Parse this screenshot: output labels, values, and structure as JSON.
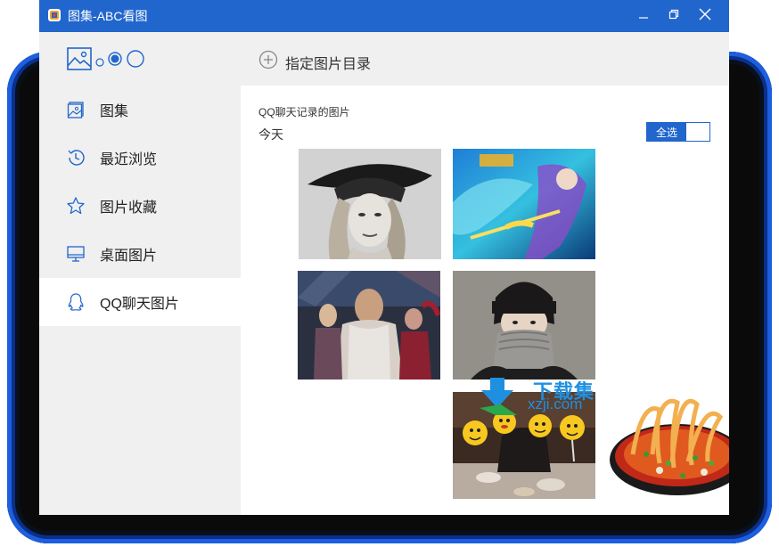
{
  "window": {
    "title": "图集-ABC看图",
    "controls": [
      "minimize-icon",
      "restore-icon",
      "close-icon"
    ],
    "accent": "#2166cc"
  },
  "sidebar": {
    "view_toggle": [
      "image-view-icon",
      "small-dot",
      "medium-dot-selected",
      "large-circle"
    ],
    "items": [
      {
        "label": "图集",
        "icon": "gallery-icon",
        "active": false
      },
      {
        "label": "最近浏览",
        "icon": "history-icon",
        "active": false
      },
      {
        "label": "图片收藏",
        "icon": "star-icon",
        "active": false
      },
      {
        "label": "桌面图片",
        "icon": "monitor-icon",
        "active": false
      },
      {
        "label": "QQ聊天图片",
        "icon": "qq-penguin-icon",
        "active": true
      }
    ]
  },
  "main": {
    "add_directory_label": "指定图片目录",
    "section_title": "QQ聊天记录的图片",
    "day_label": "今天",
    "select_all_label": "全选",
    "thumbnails": [
      "woman-in-hat-bw-photo",
      "game-warrior-dragon-art",
      "movie-poster-heroes",
      "person-turtleneck-photo",
      "emoji-masks-group-photo",
      "noodle-bowl-photo"
    ]
  },
  "watermark": {
    "text": "下载集",
    "url": "xzji.com"
  }
}
